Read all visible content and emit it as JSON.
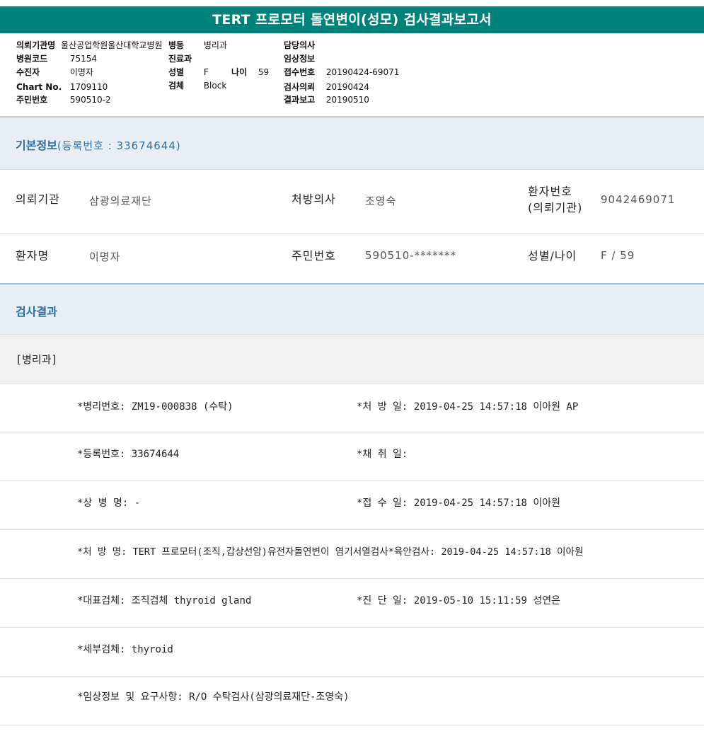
{
  "title": "TERT 프로모터 돌연변이(성모) 검사결과보고서",
  "header": {
    "col1": [
      {
        "label": "의뢰기관명",
        "value": "울산공업학원울산대학교병원"
      },
      {
        "label": "병원코드",
        "value": "75154"
      },
      {
        "label": "수진자",
        "value": "이명자"
      },
      {
        "label": "Chart No.",
        "value": "1709110"
      },
      {
        "label": "주민번호",
        "value": "590510-2"
      }
    ],
    "col2": [
      {
        "label": "병동",
        "value": "병리과"
      },
      {
        "label": "진료과",
        "value": ""
      },
      {
        "label": "성별",
        "value": "F"
      },
      {
        "label": "검체",
        "value": "Block"
      }
    ],
    "age": {
      "label": "나이",
      "value": "59"
    },
    "col3": [
      {
        "label": "담당의사",
        "value": ""
      },
      {
        "label": "임상정보",
        "value": ""
      },
      {
        "label": "접수번호",
        "value": "20190424-69071"
      },
      {
        "label": "검사의뢰",
        "value": "20190424"
      },
      {
        "label": "결과보고",
        "value": "20190510"
      }
    ]
  },
  "basic_info": {
    "title": "기본정보",
    "subtitle": "(등록번호 : 33674644)",
    "row1": {
      "inst_label": "의뢰기관",
      "inst_value": "삼광의료재단",
      "doctor_label": "처방의사",
      "doctor_value": "조영숙",
      "patno_label_1": "환자번호",
      "patno_label_2": "(의뢰기관)",
      "patno_value": "9042469071"
    },
    "row2": {
      "name_label": "환자명",
      "name_value": "이명자",
      "rrn_label": "주민번호",
      "rrn_value": "590510-*******",
      "sex_label": "성별/나이",
      "sex_value": "F / 59"
    }
  },
  "results": {
    "title": "검사결과",
    "department": "[병리과]",
    "rows": [
      {
        "left": "*병리번호: ZM19-000838 (수탁)",
        "right": "*처 방 일: 2019-04-25 14:57:18  이아원 AP"
      },
      {
        "left": "*등록번호: 33674644",
        "right": "*채 취 일:"
      },
      {
        "left": "*상 병 명: -",
        "right": "*접 수 일: 2019-04-25 14:57:18  이아원"
      },
      {
        "left": "*처 방 명: TERT 프로모터(조직,갑상선암)유전자돌연변이 염기서열검사*육안검사: 2019-04-25 14:57:18  이아원",
        "right": ""
      },
      {
        "left": "*대표검체: 조직검체 thyroid gland",
        "right": "*진 단 일: 2019-05-10 15:11:59  성연은"
      },
      {
        "left": "*세부검체: thyroid",
        "right": ""
      },
      {
        "left": "*임상정보 및 요구사항: R/O 수탁검사(삼광의료재단-조영숙)",
        "right": ""
      }
    ]
  }
}
